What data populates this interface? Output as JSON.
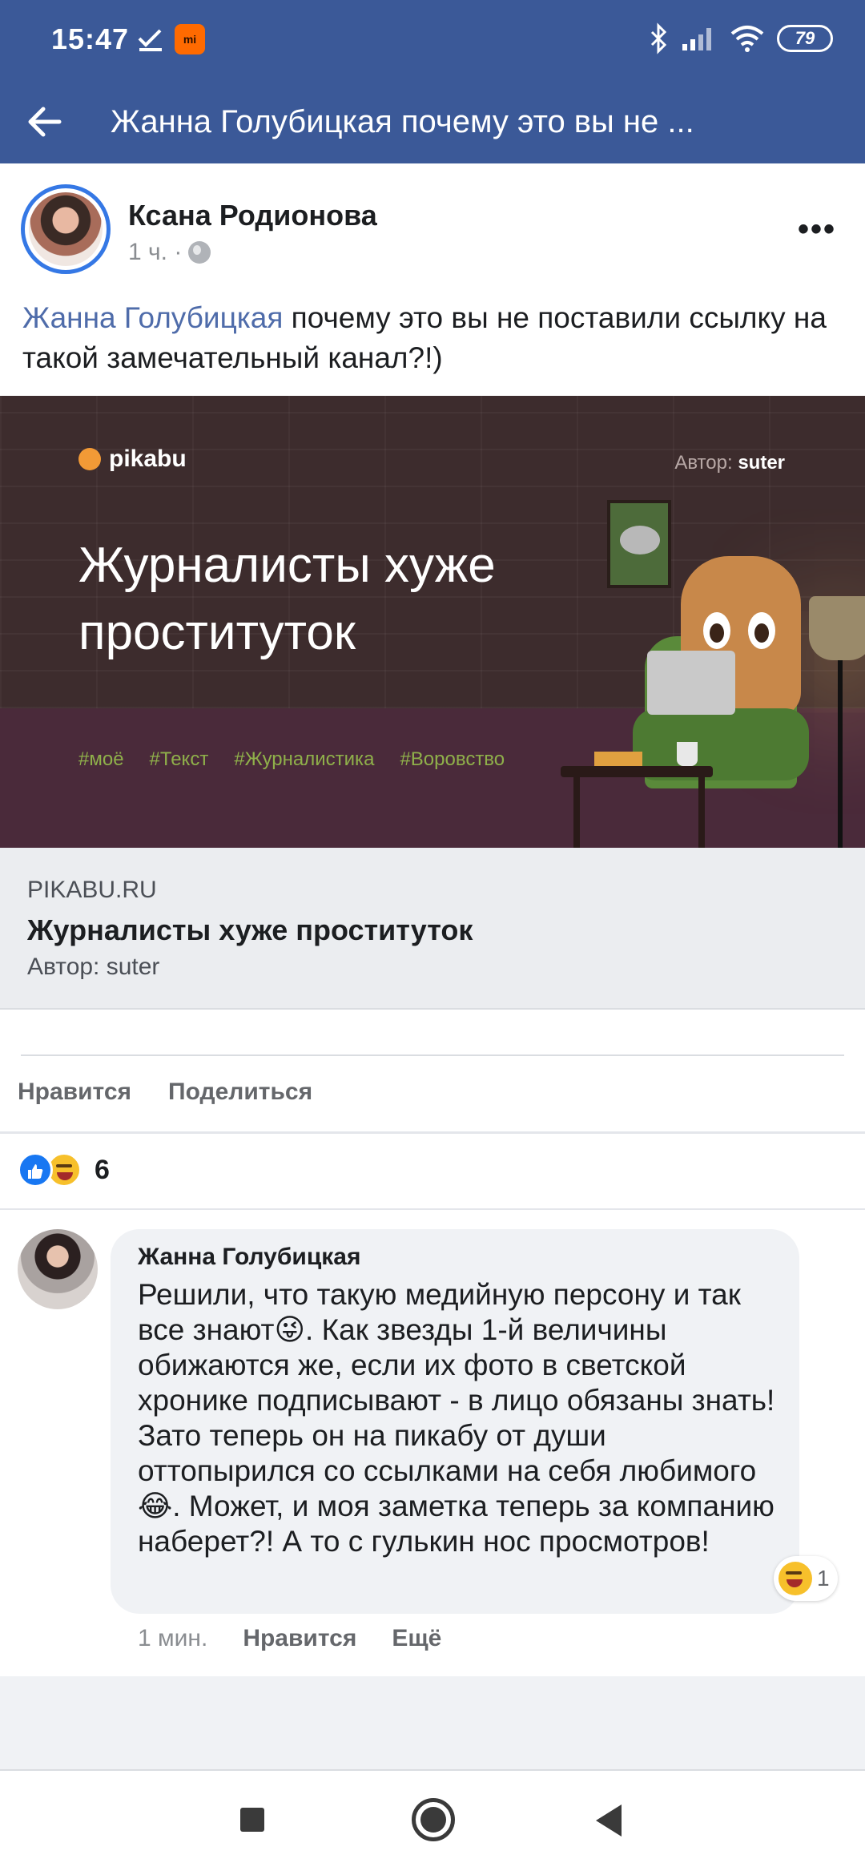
{
  "status_bar": {
    "time": "15:47",
    "app_badge": "mi",
    "battery": "79"
  },
  "top_bar": {
    "title": "Жанна Голубицкая почему это вы не ..."
  },
  "post": {
    "author": "Ксана Родионова",
    "time": "1 ч. ·",
    "text_mention": "Жанна Голубицкая",
    "text_rest": " почему это вы не поставили ссылку на такой замечательный канал?!)",
    "more_label": "•••"
  },
  "link_image": {
    "brand": "pikabu",
    "author_prefix": "Автор: ",
    "author_name": "suter",
    "title": "Журналисты хуже проституток",
    "tags": [
      "#моё",
      "#Текст",
      "#Журналистика",
      "#Воровство"
    ],
    "colors": {
      "accent_tag": "#8fb04a",
      "brand": "#f29a36"
    }
  },
  "link_caption": {
    "domain": "PIKABU.RU",
    "title": "Журналисты хуже проституток",
    "subtitle": "Автор: suter"
  },
  "actions": {
    "like": "Нравится",
    "share": "Поделиться"
  },
  "reactions": {
    "count": "6"
  },
  "comment": {
    "author": "Жанна Голубицкая",
    "text": "Решили, что такую медийную персону и так все знают😜. Как звезды 1-й величины обижаются же, если их фото в светской хронике подписывают - в лицо обязаны знать! Зато теперь он на пикабу от души оттопырился со ссылками на себя любимого😂. Может, и моя заметка теперь за компанию наберет?! А то с гулькин нос просмотров!",
    "reaction_count": "1",
    "time": "1 мин.",
    "like": "Нравится",
    "more": "Ещё"
  },
  "colors": {
    "header_bg": "#3b5998",
    "mention": "#4f6caa",
    "like_blue": "#1877f2"
  }
}
